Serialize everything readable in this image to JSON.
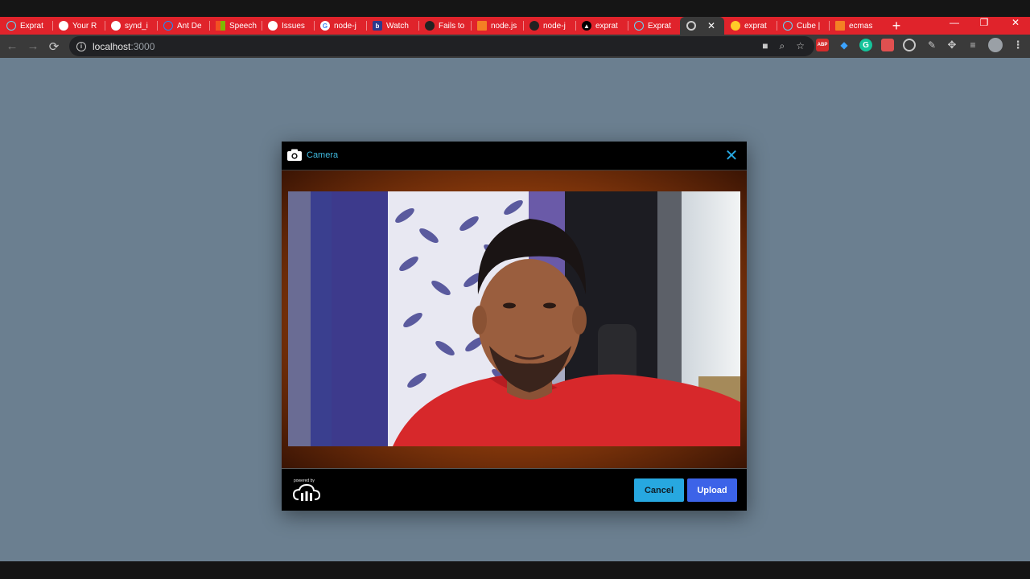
{
  "browser": {
    "tabs": [
      {
        "label": "Exprat",
        "icon": "react-icon",
        "color": "#61dafb"
      },
      {
        "label": "Your R",
        "icon": "github-icon",
        "color": "#ffffff"
      },
      {
        "label": "synd_i",
        "icon": "github-icon",
        "color": "#ffffff"
      },
      {
        "label": "Ant De",
        "icon": "ant-design-icon",
        "color": "#1890ff"
      },
      {
        "label": "Speech",
        "icon": "microsoft-icon",
        "color": "#f25022"
      },
      {
        "label": "Issues",
        "icon": "github-icon",
        "color": "#ffffff"
      },
      {
        "label": "node-j",
        "icon": "google-icon",
        "color": "#ffffff"
      },
      {
        "label": "Watch",
        "icon": "bh-icon",
        "color": "#2b3a8c"
      },
      {
        "label": "Fails to",
        "icon": "github-icon",
        "color": "#ffffff"
      },
      {
        "label": "node.js",
        "icon": "stackoverflow-icon",
        "color": "#f48024"
      },
      {
        "label": "node-j",
        "icon": "github-icon",
        "color": "#ffffff"
      },
      {
        "label": "exprat",
        "icon": "vercel-icon",
        "color": "#000000"
      },
      {
        "label": "Exprat",
        "icon": "react-icon",
        "color": "#61dafb"
      },
      {
        "label": "",
        "icon": "loading-icon",
        "color": "#cccccc",
        "active": true
      },
      {
        "label": "exprat",
        "icon": "firebase-icon",
        "color": "#ffca28"
      },
      {
        "label": "Cube |",
        "icon": "react-icon",
        "color": "#61dafb"
      },
      {
        "label": "ecmas",
        "icon": "stackoverflow-icon",
        "color": "#f48024"
      }
    ],
    "url_host": "localhost",
    "url_port": ":3000",
    "extensions": [
      "ABP",
      "G"
    ]
  },
  "modal": {
    "title": "Camera",
    "powered_by": "powered by",
    "cancel_label": "Cancel",
    "upload_label": "Upload",
    "accent_color": "#27a8e0",
    "upload_color": "#3c63e8"
  },
  "page": {
    "background_color": "#6b7f90"
  }
}
